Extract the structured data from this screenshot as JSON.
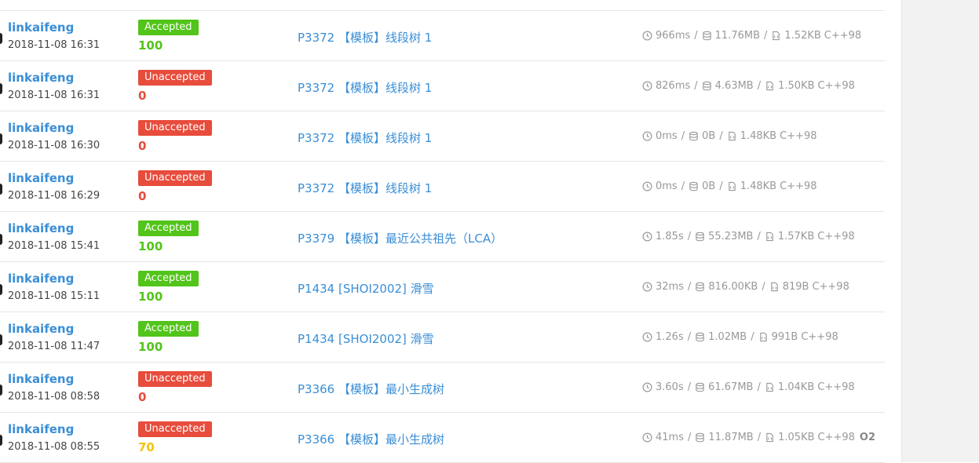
{
  "colors": {
    "accepted": "#52c41a",
    "unaccepted": "#e74c3c",
    "partial": "#f1c40f",
    "link": "#3a8ed6",
    "muted": "#999999"
  },
  "icons": {
    "time": "clock-icon",
    "memory": "database-icon",
    "code": "code-file-icon"
  },
  "records": [
    {
      "user": "linkaifeng",
      "time": "2018-11-08 16:31",
      "status": "Accepted",
      "status_type": "ok",
      "score": "100",
      "score_color": "green",
      "problem": "P3372 【模板】线段树 1",
      "runtime": "966ms",
      "memory": "11.76MB",
      "code_size": "1.52KB",
      "lang": "C++98",
      "o2": ""
    },
    {
      "user": "linkaifeng",
      "time": "2018-11-08 16:31",
      "status": "Unaccepted",
      "status_type": "bad",
      "score": "0",
      "score_color": "red",
      "problem": "P3372 【模板】线段树 1",
      "runtime": "826ms",
      "memory": "4.63MB",
      "code_size": "1.50KB",
      "lang": "C++98",
      "o2": ""
    },
    {
      "user": "linkaifeng",
      "time": "2018-11-08 16:30",
      "status": "Unaccepted",
      "status_type": "bad",
      "score": "0",
      "score_color": "red",
      "problem": "P3372 【模板】线段树 1",
      "runtime": "0ms",
      "memory": "0B",
      "code_size": "1.48KB",
      "lang": "C++98",
      "o2": ""
    },
    {
      "user": "linkaifeng",
      "time": "2018-11-08 16:29",
      "status": "Unaccepted",
      "status_type": "bad",
      "score": "0",
      "score_color": "red",
      "problem": "P3372 【模板】线段树 1",
      "runtime": "0ms",
      "memory": "0B",
      "code_size": "1.48KB",
      "lang": "C++98",
      "o2": ""
    },
    {
      "user": "linkaifeng",
      "time": "2018-11-08 15:41",
      "status": "Accepted",
      "status_type": "ok",
      "score": "100",
      "score_color": "green",
      "problem": "P3379 【模板】最近公共祖先（LCA）",
      "runtime": "1.85s",
      "memory": "55.23MB",
      "code_size": "1.57KB",
      "lang": "C++98",
      "o2": ""
    },
    {
      "user": "linkaifeng",
      "time": "2018-11-08 15:11",
      "status": "Accepted",
      "status_type": "ok",
      "score": "100",
      "score_color": "green",
      "problem": "P1434 [SHOI2002] 滑雪",
      "runtime": "32ms",
      "memory": "816.00KB",
      "code_size": "819B",
      "lang": "C++98",
      "o2": ""
    },
    {
      "user": "linkaifeng",
      "time": "2018-11-08 11:47",
      "status": "Accepted",
      "status_type": "ok",
      "score": "100",
      "score_color": "green",
      "problem": "P1434 [SHOI2002] 滑雪",
      "runtime": "1.26s",
      "memory": "1.02MB",
      "code_size": "991B",
      "lang": "C++98",
      "o2": ""
    },
    {
      "user": "linkaifeng",
      "time": "2018-11-08 08:58",
      "status": "Unaccepted",
      "status_type": "bad",
      "score": "0",
      "score_color": "red",
      "problem": "P3366 【模板】最小生成树",
      "runtime": "3.60s",
      "memory": "61.67MB",
      "code_size": "1.04KB",
      "lang": "C++98",
      "o2": ""
    },
    {
      "user": "linkaifeng",
      "time": "2018-11-08 08:55",
      "status": "Unaccepted",
      "status_type": "bad",
      "score": "70",
      "score_color": "yellow",
      "problem": "P3366 【模板】最小生成树",
      "runtime": "41ms",
      "memory": "11.87MB",
      "code_size": "1.05KB",
      "lang": "C++98",
      "o2": "O2"
    }
  ]
}
